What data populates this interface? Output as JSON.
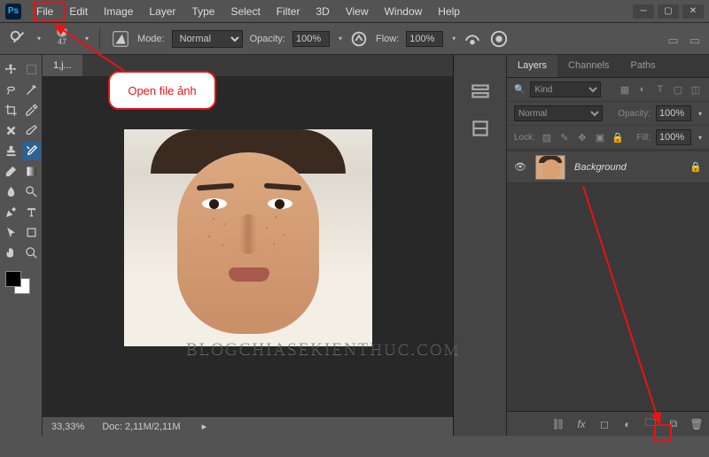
{
  "menubar": {
    "items": [
      "File",
      "Edit",
      "Image",
      "Layer",
      "Type",
      "Select",
      "Filter",
      "3D",
      "View",
      "Window",
      "Help"
    ]
  },
  "options": {
    "brush_size": "47",
    "mode_label": "Mode:",
    "mode_value": "Normal",
    "opacity_label": "Opacity:",
    "opacity_value": "100%",
    "flow_label": "Flow:",
    "flow_value": "100%"
  },
  "doc": {
    "tab": "1,j...",
    "zoom": "33,33%",
    "docinfo": "Doc:  2,11M/2,11M"
  },
  "panel": {
    "tabs": [
      "Layers",
      "Channels",
      "Paths"
    ],
    "filter_placeholder": "Kind",
    "blend_mode": "Normal",
    "opacity_label": "Opacity:",
    "opacity_value": "100%",
    "lock_label": "Lock:",
    "fill_label": "Fill:",
    "fill_value": "100%",
    "layer_name": "Background"
  },
  "callout": {
    "text": "Open file ảnh"
  },
  "watermark": "BLOGCHIASEKIENTHUC.COM"
}
